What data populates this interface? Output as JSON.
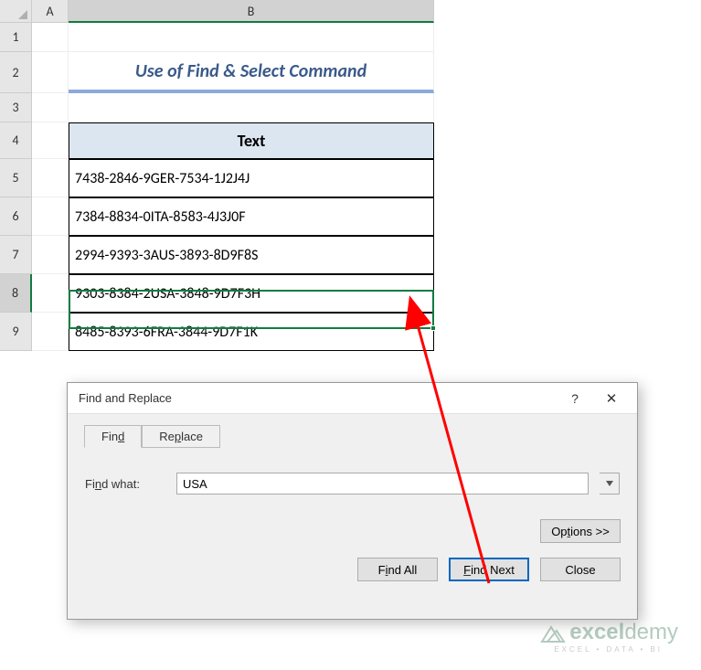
{
  "columns": {
    "A": "A",
    "B": "B"
  },
  "rows": [
    "1",
    "2",
    "3",
    "4",
    "5",
    "6",
    "7",
    "8",
    "9"
  ],
  "title": "Use of Find & Select Command",
  "table": {
    "header": "Text",
    "data": [
      "7438-2846-9GER-7534-1J2J4J",
      "7384-8834-0ITA-8583-4J3J0F",
      "2994-9393-3AUS-3893-8D9F8S",
      "9303-8384-2USA-3848-9D7F3H",
      "8485-8393-6FRA-3844-9D7F1K"
    ]
  },
  "active_cell": "B8",
  "dialog": {
    "title": "Find and Replace",
    "tabs": {
      "find": "Find",
      "replace": "Replace"
    },
    "find_what_label": "Find what:",
    "find_what_value": "USA",
    "options_label": "Options >>",
    "buttons": {
      "find_all": "Find All",
      "find_next": "Find Next",
      "close": "Close"
    },
    "help": "?",
    "close": "✕"
  },
  "watermark": {
    "brand_bold": "excel",
    "brand_rest": "demy",
    "tag": "EXCEL • DATA • BI"
  }
}
